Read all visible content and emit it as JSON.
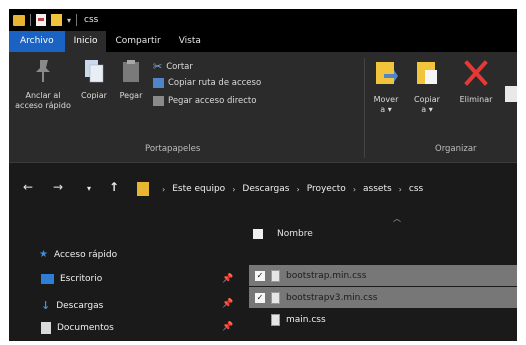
{
  "title_bar": {
    "folder_name": "css",
    "quick_access_dropdown": "▾"
  },
  "tabs": [
    "Archivo",
    "Inicio",
    "Compartir",
    "Vista"
  ],
  "ribbon": {
    "portapapeles": {
      "label": "Portapapeles",
      "pin_label_line1": "Anclar al",
      "pin_label_line2": "acceso rápido",
      "copy_label": "Copiar",
      "paste_label": "Pegar",
      "cut_label": "Cortar",
      "copy_path_label": "Copiar ruta de acceso",
      "paste_shortcut_label": "Pegar acceso directo"
    },
    "organizar": {
      "label": "Organizar",
      "move_label_line1": "Mover",
      "move_label_line2": "a ▾",
      "copy_to_label_line1": "Copiar",
      "copy_to_label_line2": "a ▾",
      "delete_label": "Eliminar"
    }
  },
  "address_bar": {
    "back": "←",
    "forward": "→",
    "recent": "▾",
    "up": "↑",
    "crumbs": [
      "Este equipo",
      "Descargas",
      "Proyecto",
      "assets",
      "css"
    ]
  },
  "nav_pane": {
    "quick_access": "Acceso rápido",
    "items": [
      "Escritorio",
      "Descargas",
      "Documentos"
    ]
  },
  "content": {
    "column_name": "Nombre",
    "files": [
      {
        "name": "bootstrap.min.css",
        "selected": true
      },
      {
        "name": "bootstrapv3.min.css",
        "selected": true
      },
      {
        "name": "main.css",
        "selected": false
      }
    ]
  },
  "colors": {
    "file_tab": "#1b63c2",
    "window_bg": "#1a1a1a",
    "ribbon_bg": "#2b2b2b",
    "selection": "#777777",
    "folder": "#e8b530",
    "delete_red": "#e53935"
  },
  "icons": [
    "pin-icon",
    "copy-icon",
    "paste-icon",
    "cut-icon",
    "copy-path-icon",
    "paste-shortcut-icon",
    "move-to-icon",
    "copy-to-icon",
    "delete-icon",
    "folder-icon",
    "star-icon",
    "desktop-icon",
    "download-icon",
    "document-icon",
    "file-icon"
  ]
}
